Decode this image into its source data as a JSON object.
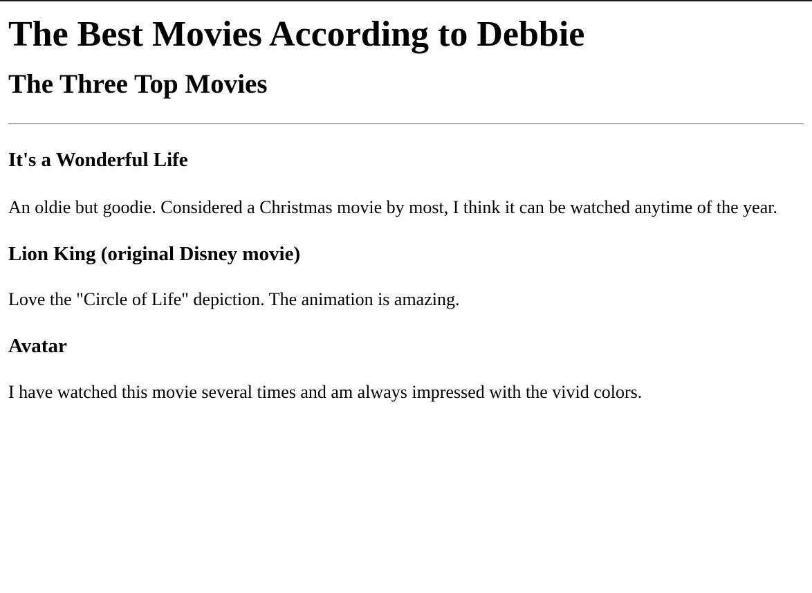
{
  "header": {
    "title": "The Best Movies According to Debbie",
    "subtitle": "The Three Top Movies"
  },
  "movies": [
    {
      "title": "It's a Wonderful Life",
      "description": "An oldie but goodie. Considered a Christmas movie by most, I think it can be watched anytime of the year."
    },
    {
      "title": "Lion King (original Disney movie)",
      "description": "Love the \"Circle of Life\" depiction. The animation is amazing."
    },
    {
      "title": "Avatar",
      "description": "I have watched this movie several times and am always impressed with the vivid colors."
    }
  ]
}
